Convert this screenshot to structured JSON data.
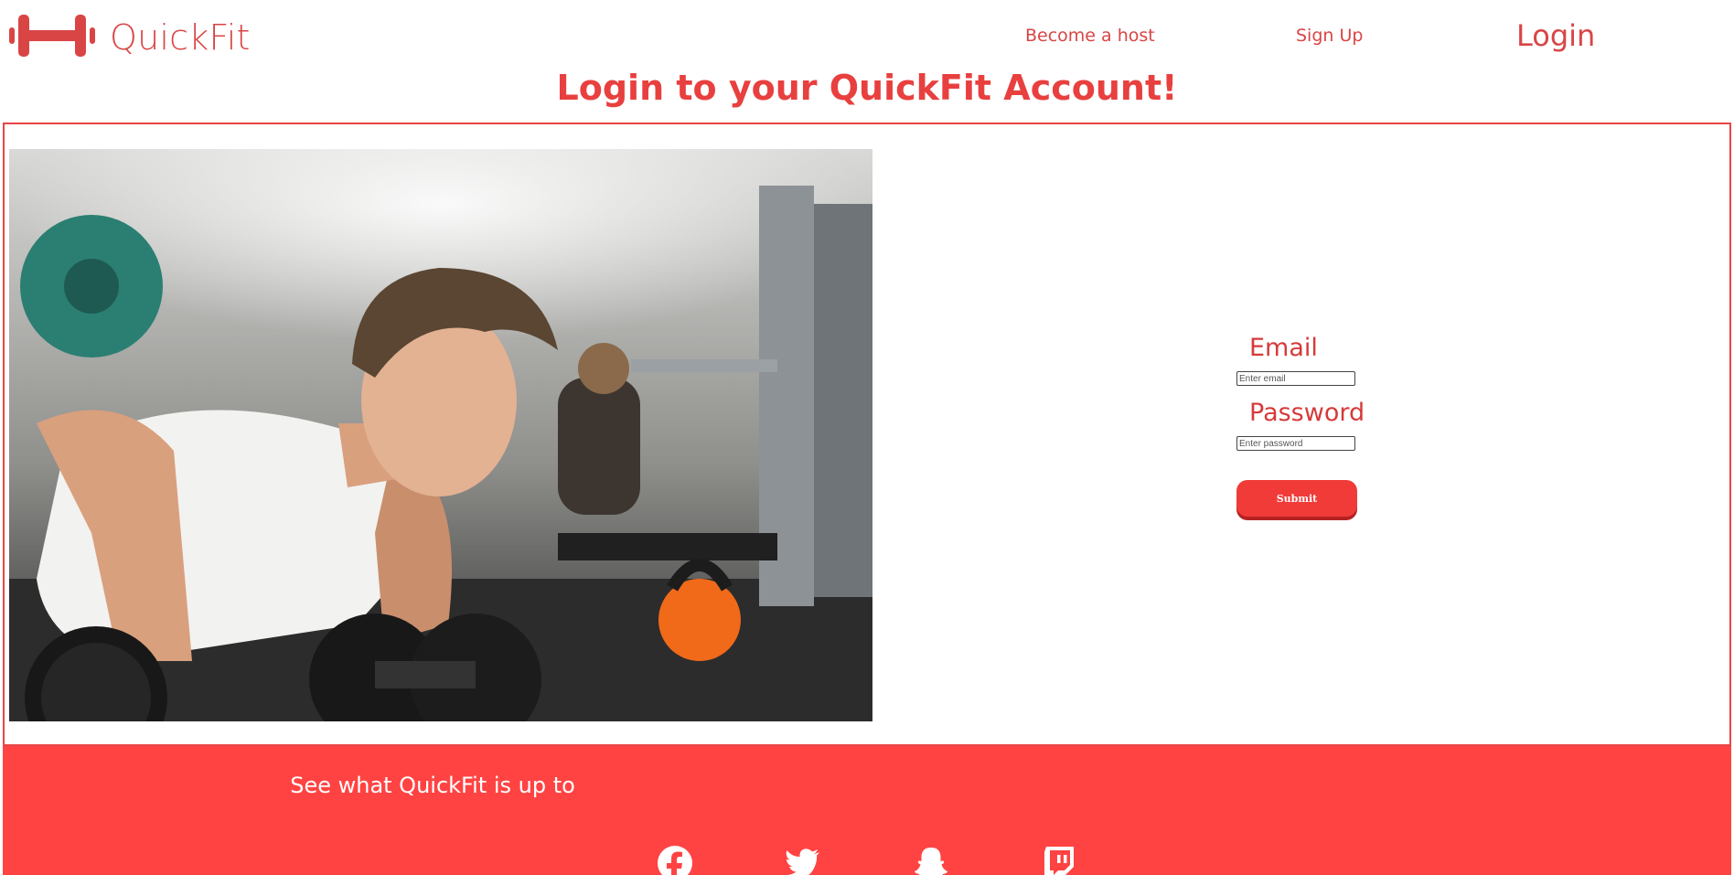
{
  "brand": {
    "name": "QuickFit",
    "logo_icon": "dumbbell-icon",
    "color": "#d94545"
  },
  "nav": {
    "host_label": "Become a host",
    "signup_label": "Sign Up",
    "login_label": "Login"
  },
  "page": {
    "title": "Login to your QuickFit Account!"
  },
  "hero_image": {
    "icon": "gym-pushup-photo"
  },
  "form": {
    "email_label": "Email",
    "email_placeholder": "Enter email",
    "email_value": "",
    "password_label": "Password",
    "password_placeholder": "Enter password",
    "password_value": "",
    "submit_label": "Submit"
  },
  "footer": {
    "title": "See what QuickFit is up to",
    "background": "#ff4343",
    "socials": [
      {
        "icon": "facebook-icon"
      },
      {
        "icon": "twitter-icon"
      },
      {
        "icon": "snapchat-icon"
      },
      {
        "icon": "twitch-icon"
      }
    ]
  }
}
